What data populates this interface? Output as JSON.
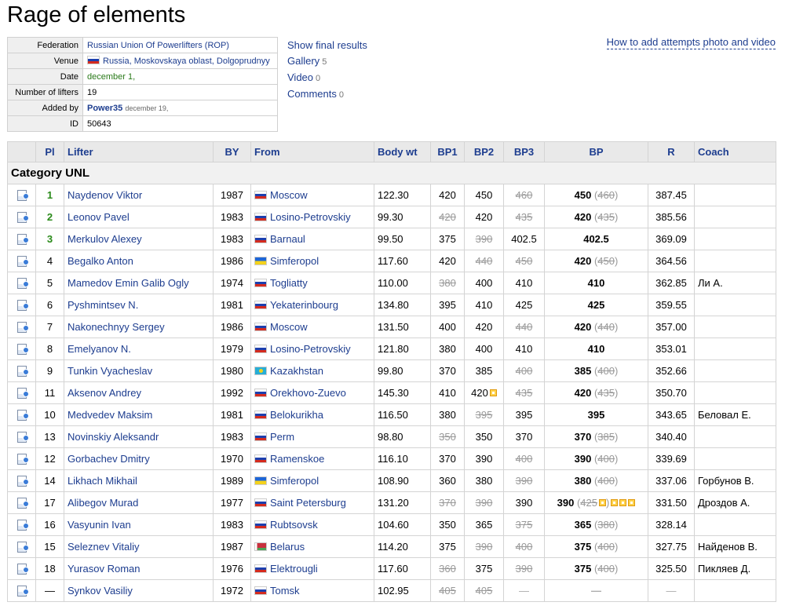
{
  "title": "Rage of elements",
  "info": {
    "federation_label": "Federation",
    "federation_value": "Russian Union Of Powerlifters (ROP)",
    "venue_label": "Venue",
    "venue_value": "Russia, Moskovskaya oblast, Dolgoprudnyy",
    "date_label": "Date",
    "date_value": "december 1,",
    "lifters_label": "Number of lifters",
    "lifters_value": "19",
    "added_label": "Added by",
    "added_user": "Power35",
    "added_date": "december 19,",
    "id_label": "ID",
    "id_value": "50643"
  },
  "side_links": {
    "final": "Show final results",
    "gallery": "Gallery",
    "gallery_count": "5",
    "video": "Video",
    "video_count": "0",
    "comments": "Comments",
    "comments_count": "0"
  },
  "help_link": "How to add attempts photo and video",
  "columns": [
    "Pl",
    "Lifter",
    "BY",
    "From",
    "Body wt",
    "BP1",
    "BP2",
    "BP3",
    "BP",
    "R",
    "Coach"
  ],
  "category": "Category UNL",
  "rows": [
    {
      "pl": "1",
      "lifter": "Naydenov Viktor",
      "by": "1987",
      "flag": "ru",
      "from": "Moscow",
      "bw": "122.30",
      "bp1": "420",
      "bp1s": false,
      "bp2": "450",
      "bp2s": false,
      "bp3": "460",
      "bp3s": true,
      "bp": "450",
      "bpx": "460",
      "r": "387.45",
      "coach": ""
    },
    {
      "pl": "2",
      "lifter": "Leonov Pavel",
      "by": "1983",
      "flag": "ru",
      "from": "Losino-Petrovskiy",
      "bw": "99.30",
      "bp1": "420",
      "bp1s": true,
      "bp2": "420",
      "bp2s": false,
      "bp3": "435",
      "bp3s": true,
      "bp": "420",
      "bpx": "435",
      "r": "385.56",
      "coach": ""
    },
    {
      "pl": "3",
      "lifter": "Merkulov Alexey",
      "by": "1983",
      "flag": "ru",
      "from": "Barnaul",
      "bw": "99.50",
      "bp1": "375",
      "bp1s": false,
      "bp2": "390",
      "bp2s": true,
      "bp3": "402.5",
      "bp3s": false,
      "bp": "402.5",
      "bpx": "",
      "r": "369.09",
      "coach": ""
    },
    {
      "pl": "4",
      "lifter": "Begalko Anton",
      "by": "1986",
      "flag": "ua",
      "from": "Simferopol",
      "bw": "117.60",
      "bp1": "420",
      "bp1s": false,
      "bp2": "440",
      "bp2s": true,
      "bp3": "450",
      "bp3s": true,
      "bp": "420",
      "bpx": "450",
      "r": "364.56",
      "coach": ""
    },
    {
      "pl": "5",
      "lifter": "Mamedov Emin Galib Ogly",
      "by": "1974",
      "flag": "ru",
      "from": "Togliatty",
      "bw": "110.00",
      "bp1": "380",
      "bp1s": true,
      "bp2": "400",
      "bp2s": false,
      "bp3": "410",
      "bp3s": false,
      "bp": "410",
      "bpx": "",
      "r": "362.85",
      "coach": "Ли А."
    },
    {
      "pl": "6",
      "lifter": "Pyshmintsev N.",
      "by": "1981",
      "flag": "ru",
      "from": "Yekaterinbourg",
      "bw": "134.80",
      "bp1": "395",
      "bp1s": false,
      "bp2": "410",
      "bp2s": false,
      "bp3": "425",
      "bp3s": false,
      "bp": "425",
      "bpx": "",
      "r": "359.55",
      "coach": ""
    },
    {
      "pl": "7",
      "lifter": "Nakonechnyy Sergey",
      "by": "1986",
      "flag": "ru",
      "from": "Moscow",
      "bw": "131.50",
      "bp1": "400",
      "bp1s": false,
      "bp2": "420",
      "bp2s": false,
      "bp3": "440",
      "bp3s": true,
      "bp": "420",
      "bpx": "440",
      "r": "357.00",
      "coach": ""
    },
    {
      "pl": "8",
      "lifter": "Emelyanov N.",
      "by": "1979",
      "flag": "ru",
      "from": "Losino-Petrovskiy",
      "bw": "121.80",
      "bp1": "380",
      "bp1s": false,
      "bp2": "400",
      "bp2s": false,
      "bp3": "410",
      "bp3s": false,
      "bp": "410",
      "bpx": "",
      "r": "353.01",
      "coach": ""
    },
    {
      "pl": "9",
      "lifter": "Tunkin Vyacheslav",
      "by": "1980",
      "flag": "kz",
      "from": "Kazakhstan",
      "bw": "99.80",
      "bp1": "370",
      "bp1s": false,
      "bp2": "385",
      "bp2s": false,
      "bp3": "400",
      "bp3s": true,
      "bp": "385",
      "bpx": "400",
      "r": "352.66",
      "coach": ""
    },
    {
      "pl": "11",
      "lifter": "Aksenov Andrey",
      "by": "1992",
      "flag": "ru",
      "from": "Orekhovo-Zuevo",
      "bw": "145.30",
      "bp1": "410",
      "bp1s": false,
      "bp2": "420",
      "bp2s": false,
      "bp2rec": 1,
      "bp3": "435",
      "bp3s": true,
      "bp": "420",
      "bpx": "435",
      "r": "350.70",
      "coach": ""
    },
    {
      "pl": "10",
      "lifter": "Medvedev Maksim",
      "by": "1981",
      "flag": "ru",
      "from": "Belokurikha",
      "bw": "116.50",
      "bp1": "380",
      "bp1s": false,
      "bp2": "395",
      "bp2s": true,
      "bp3": "395",
      "bp3s": false,
      "bp": "395",
      "bpx": "",
      "r": "343.65",
      "coach": "Беловал Е."
    },
    {
      "pl": "13",
      "lifter": "Novinskiy Aleksandr",
      "by": "1983",
      "flag": "ru",
      "from": "Perm",
      "bw": "98.80",
      "bp1": "350",
      "bp1s": true,
      "bp2": "350",
      "bp2s": false,
      "bp3": "370",
      "bp3s": false,
      "bp": "370",
      "bpx": "385",
      "r": "340.40",
      "coach": ""
    },
    {
      "pl": "12",
      "lifter": "Gorbachev Dmitry",
      "by": "1970",
      "flag": "ru",
      "from": "Ramenskoe",
      "bw": "116.10",
      "bp1": "370",
      "bp1s": false,
      "bp2": "390",
      "bp2s": false,
      "bp3": "400",
      "bp3s": true,
      "bp": "390",
      "bpx": "400",
      "r": "339.69",
      "coach": ""
    },
    {
      "pl": "14",
      "lifter": "Likhach Mikhail",
      "by": "1989",
      "flag": "ua",
      "from": "Simferopol",
      "bw": "108.90",
      "bp1": "360",
      "bp1s": false,
      "bp2": "380",
      "bp2s": false,
      "bp3": "390",
      "bp3s": true,
      "bp": "380",
      "bpx": "400",
      "r": "337.06",
      "coach": "Горбунов В."
    },
    {
      "pl": "17",
      "lifter": "Alibegov Murad",
      "by": "1977",
      "flag": "ru",
      "from": "Saint Petersburg",
      "bw": "131.20",
      "bp1": "370",
      "bp1s": true,
      "bp2": "390",
      "bp2s": true,
      "bp3": "390",
      "bp3s": false,
      "bp": "390",
      "bpx": "425",
      "bpxrec": 1,
      "bprec": 3,
      "r": "331.50",
      "coach": "Дроздов А."
    },
    {
      "pl": "16",
      "lifter": "Vasyunin Ivan",
      "by": "1983",
      "flag": "ru",
      "from": "Rubtsovsk",
      "bw": "104.60",
      "bp1": "350",
      "bp1s": false,
      "bp2": "365",
      "bp2s": false,
      "bp3": "375",
      "bp3s": true,
      "bp": "365",
      "bpx": "380",
      "r": "328.14",
      "coach": ""
    },
    {
      "pl": "15",
      "lifter": "Seleznev Vitaliy",
      "by": "1987",
      "flag": "by",
      "from": "Belarus",
      "bw": "114.20",
      "bp1": "375",
      "bp1s": false,
      "bp2": "390",
      "bp2s": true,
      "bp3": "400",
      "bp3s": true,
      "bp": "375",
      "bpx": "400",
      "r": "327.75",
      "coach": "Найденов В."
    },
    {
      "pl": "18",
      "lifter": "Yurasov Roman",
      "by": "1976",
      "flag": "ru",
      "from": "Elektrougli",
      "bw": "117.60",
      "bp1": "360",
      "bp1s": true,
      "bp2": "375",
      "bp2s": false,
      "bp3": "390",
      "bp3s": true,
      "bp": "375",
      "bpx": "400",
      "r": "325.50",
      "coach": "Пикляев Д."
    },
    {
      "pl": "—",
      "lifter": "Synkov Vasiliy",
      "by": "1972",
      "flag": "ru",
      "from": "Tomsk",
      "bw": "102.95",
      "bp1": "405",
      "bp1s": true,
      "bp2": "405",
      "bp2s": true,
      "bp3": "—",
      "bp3s": false,
      "bp": "—",
      "bpx": "",
      "r": "—",
      "coach": ""
    }
  ]
}
